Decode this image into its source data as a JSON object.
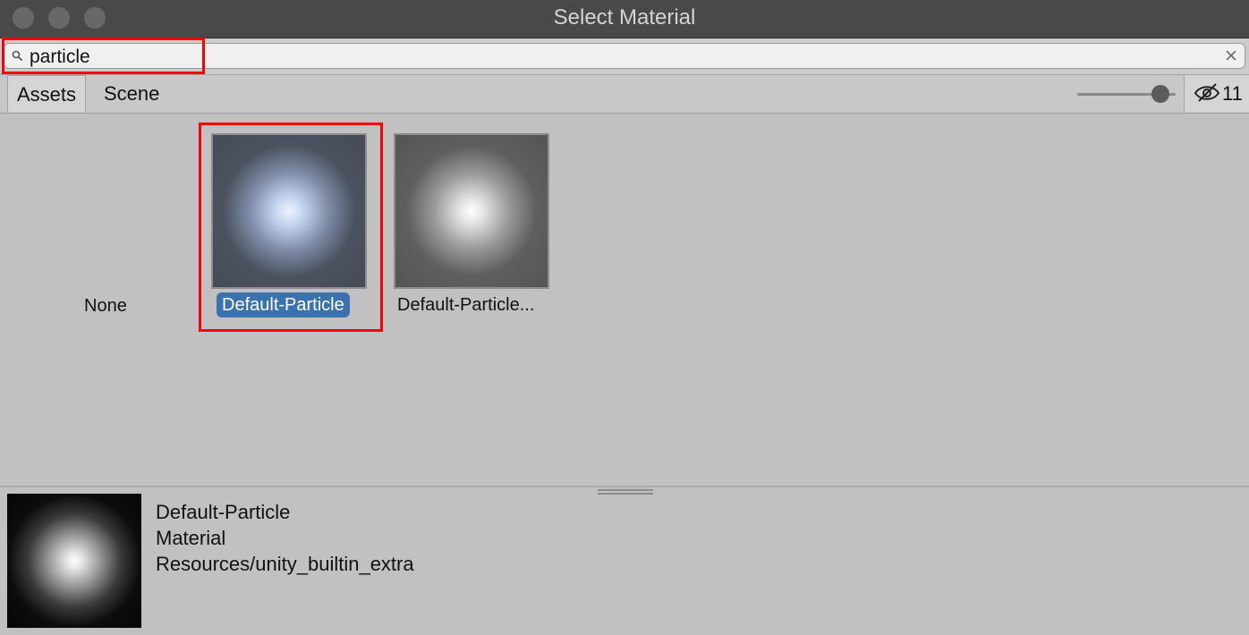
{
  "window": {
    "title": "Select Material"
  },
  "search": {
    "value": "particle"
  },
  "tabs": {
    "assets": "Assets",
    "scene": "Scene"
  },
  "toolbar": {
    "hidden_count": "11"
  },
  "grid": {
    "none_label": "None",
    "items": [
      {
        "label": "Default-Particle",
        "selected": true
      },
      {
        "label": "Default-Particle..."
      }
    ]
  },
  "preview": {
    "name": "Default-Particle",
    "type": "Material",
    "path": "Resources/unity_builtin_extra"
  },
  "colors": {
    "highlight": "#ff0000",
    "selection": "#3a72b0",
    "titlebar": "#494949"
  }
}
